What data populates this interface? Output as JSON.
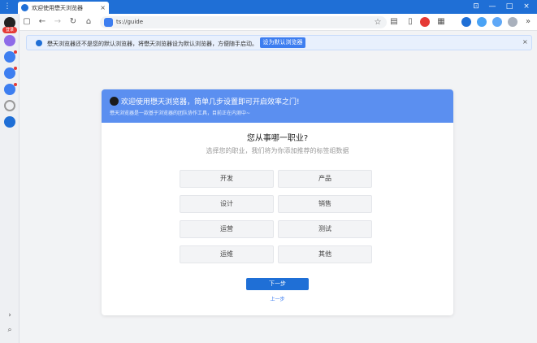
{
  "window": {
    "menu_icon": "⋮",
    "tab_title": "欢迎使用懋天浏览器",
    "tab_close": "×",
    "controls": {
      "pin": "⊡",
      "minimize": "—",
      "maximize": "□",
      "close": "×"
    }
  },
  "sidebar": {
    "badge": "登录",
    "chevron": "›",
    "search": "⌕"
  },
  "toolbar": {
    "sidebar_toggle": "▢",
    "back": "←",
    "forward": "→",
    "reload": "↻",
    "home": "⌂",
    "url": "ts://guide",
    "star": "☆",
    "collections": "▤",
    "reading": "▯",
    "apps": "▦",
    "overflow": "»"
  },
  "notice": {
    "text": "懋天浏览器还不是您的默认浏览器，将懋天浏览器设为默认浏览器，方便随手启动。",
    "button": "设为默认浏览器",
    "close": "×"
  },
  "guide": {
    "title": "欢迎使用懋天浏览器，简单几步设置即可开启效率之门!",
    "subtitle": "懋天浏览器是一款基于浏览器的团队协作工具，目前正在内测中~",
    "question": "您从事哪一职业?",
    "hint": "选择您的职业，我们将为你添加推荐的标签组数据",
    "options": [
      "开发",
      "产品",
      "设计",
      "销售",
      "运营",
      "测试",
      "运维",
      "其他"
    ],
    "next": "下一步",
    "prev": "上一步"
  },
  "colors": {
    "titlebar": "#1f6fd6",
    "dialog_header": "#5b8ff0",
    "primary_button": "#1f6fd6",
    "notice_bg": "#e8f0fd"
  }
}
